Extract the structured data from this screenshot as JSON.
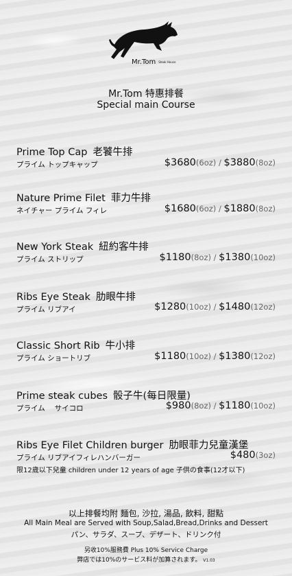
{
  "brand": {
    "name": "Mr.Tom",
    "sub": "Steak House"
  },
  "header": {
    "title_line1": "Mr.Tom 特惠排餐",
    "title_line2": "Special main Course"
  },
  "items": [
    {
      "name": "Prime Top Cap",
      "zh": "老饕牛排",
      "jp": "プライム トップキャップ",
      "p1": "$3680",
      "w1": "(6oz)",
      "sep": " / ",
      "p2": "$3880",
      "w2": "(8oz)"
    },
    {
      "name": "Nature Prime Filet",
      "zh": "菲力牛排",
      "jp": "ネイチャー プライム フィレ",
      "p1": "$1680",
      "w1": "(6oz)",
      "sep": " / ",
      "p2": "$1880",
      "w2": "(8oz)"
    },
    {
      "name": "New York Steak",
      "zh": "紐約客牛排",
      "jp": "プライム ストリップ",
      "p1": "$1180",
      "w1": "(8oz)",
      "sep": " / ",
      "p2": "$1380",
      "w2": "(10oz)"
    },
    {
      "name": "Ribs Eye Steak",
      "zh": "肋眼牛排",
      "jp": "プライム リブアイ",
      "p1": "$1280",
      "w1": "(10oz)",
      "sep": " / ",
      "p2": "$1480",
      "w2": "(12oz)"
    },
    {
      "name": "Classic Short Rib",
      "zh": "牛小排",
      "jp": "プライム ショートリブ",
      "p1": "$1180",
      "w1": "(10oz)",
      "sep": " / ",
      "p2": "$1380",
      "w2": "(12oz)"
    },
    {
      "name": "Prime steak cubes",
      "zh": "骰子牛(每日限量)",
      "jp": "プライム　 サイコロ",
      "p1": "$980",
      "w1": "(8oz)",
      "sep": " / ",
      "p2": "$1180",
      "w2": "(10oz)"
    },
    {
      "name": "Ribs Eye Filet Children burger",
      "zh": "肋眼菲力兒童漢堡",
      "jp": "プライム リブアイフィレハンバーガー",
      "p1": "$480",
      "w1": "(3oz)"
    }
  ],
  "kids_note": "限12歲以下兒童  children under 12 years of age  子供の食事(12才以下)",
  "footer": {
    "line1": "以上排餐均附 麵包, 沙拉, 湯品, 飲料, 甜點",
    "line2": "All Main Meal are Served with Soup,Salad,Bread,Drinks and Dessert",
    "line3": "パン、サラダ、スープ、デザート、ドリンク付",
    "line4": "另收10%服務費  Plus 10% Service Charge",
    "line5": "弊店では10%のサービス料が加算されます。",
    "version": "V1.03"
  }
}
